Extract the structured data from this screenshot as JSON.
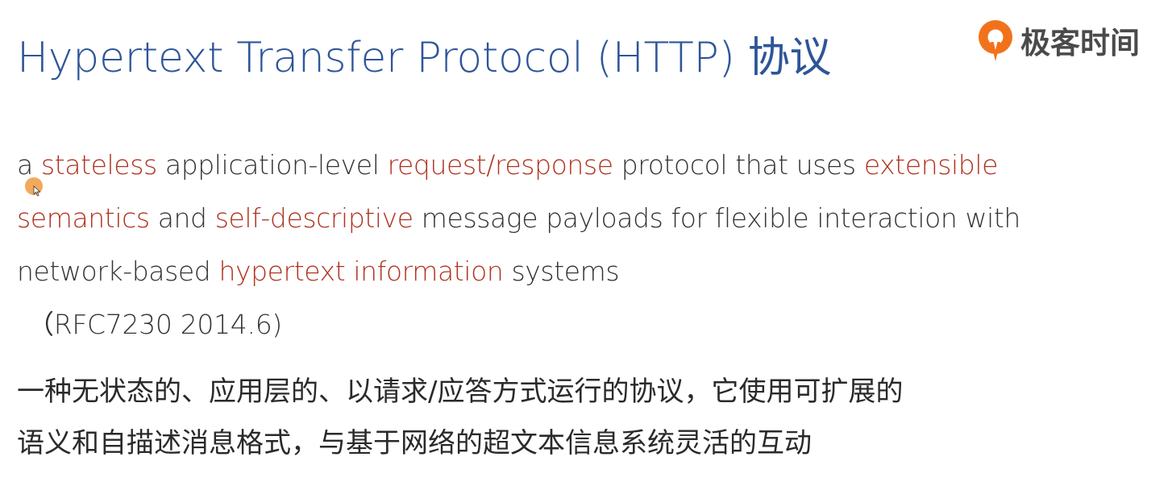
{
  "slide": {
    "title": "Hypertext Transfer Protocol (HTTP) 协议",
    "logo_text": "极客时间",
    "colors": {
      "title": "#2e5598",
      "highlight": "#b0321f",
      "body": "#333333",
      "logo_orange": "#f2721c"
    },
    "definition": {
      "p1": "a ",
      "h1": "stateless",
      "p2": " application-level ",
      "h2": "request/response",
      "p3": " protocol that uses ",
      "h3": "extensible semantics",
      "p4": " and ",
      "h4": "self-descriptive",
      "p5": " message payloads for flexible interaction with network-based ",
      "h5": "hypertext information",
      "p6": " systems"
    },
    "rfc": "（RFC7230 2014.6)",
    "translation": {
      "line1": "一种无状态的、应用层的、以请求/应答方式运行的协议，它使用可扩展的",
      "line2": "语义和自描述消息格式，与基于网络的超文本信息系统灵活的互动"
    }
  }
}
